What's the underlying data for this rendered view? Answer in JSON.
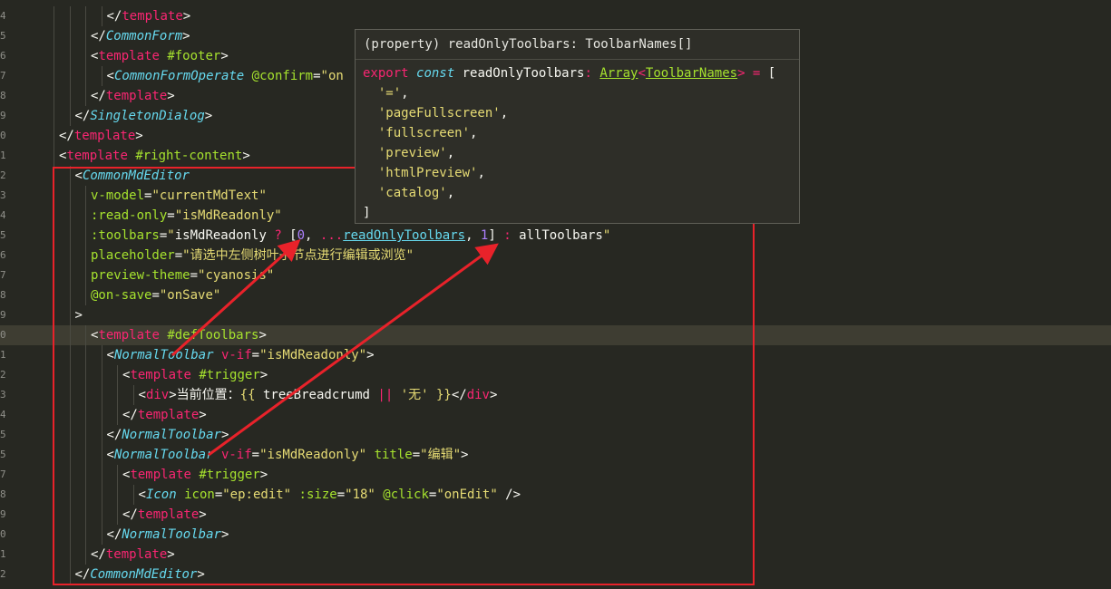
{
  "editor": {
    "current_line_index": 16,
    "lines": [
      {
        "n": "4",
        "indent": 6,
        "tokens": [
          [
            "punc",
            "</"
          ],
          [
            "tag",
            "template"
          ],
          [
            "punc",
            ">"
          ]
        ]
      },
      {
        "n": "5",
        "indent": 5,
        "tokens": [
          [
            "punc",
            "</"
          ],
          [
            "comp",
            "CommonForm"
          ],
          [
            "punc",
            ">"
          ]
        ]
      },
      {
        "n": "6",
        "indent": 5,
        "tokens": [
          [
            "punc",
            "<"
          ],
          [
            "tag",
            "template"
          ],
          [
            "punc",
            " "
          ],
          [
            "attr",
            "#footer"
          ],
          [
            "punc",
            ">"
          ]
        ]
      },
      {
        "n": "7",
        "indent": 6,
        "tokens": [
          [
            "punc",
            "<"
          ],
          [
            "comp",
            "CommonFormOperate"
          ],
          [
            "punc",
            " "
          ],
          [
            "attr",
            "@confirm"
          ],
          [
            "punc",
            "="
          ],
          [
            "str",
            "\"on"
          ]
        ]
      },
      {
        "n": "8",
        "indent": 5,
        "tokens": [
          [
            "punc",
            "</"
          ],
          [
            "tag",
            "template"
          ],
          [
            "punc",
            ">"
          ]
        ]
      },
      {
        "n": "9",
        "indent": 4,
        "tokens": [
          [
            "punc",
            "</"
          ],
          [
            "comp",
            "SingletonDialog"
          ],
          [
            "punc",
            ">"
          ]
        ]
      },
      {
        "n": "0",
        "indent": 3,
        "tokens": [
          [
            "punc",
            "</"
          ],
          [
            "tag",
            "template"
          ],
          [
            "punc",
            ">"
          ]
        ]
      },
      {
        "n": "1",
        "indent": 3,
        "tokens": [
          [
            "punc",
            "<"
          ],
          [
            "tag",
            "template"
          ],
          [
            "punc",
            " "
          ],
          [
            "attr",
            "#right-content"
          ],
          [
            "punc",
            ">"
          ]
        ]
      },
      {
        "n": "2",
        "indent": 4,
        "tokens": [
          [
            "punc",
            "<"
          ],
          [
            "comp",
            "CommonMdEditor"
          ]
        ]
      },
      {
        "n": "3",
        "indent": 5,
        "tokens": [
          [
            "attr",
            "v-model"
          ],
          [
            "punc",
            "="
          ],
          [
            "str",
            "\"currentMdText\""
          ]
        ]
      },
      {
        "n": "4",
        "indent": 5,
        "tokens": [
          [
            "attr",
            ":read-only"
          ],
          [
            "punc",
            "="
          ],
          [
            "str",
            "\"isMdReadonly\""
          ]
        ]
      },
      {
        "n": "5",
        "indent": 5,
        "tokens": [
          [
            "attr",
            ":toolbars"
          ],
          [
            "punc",
            "="
          ],
          [
            "str",
            "\""
          ],
          [
            "ident",
            "isMdReadonly "
          ],
          [
            "op",
            "?"
          ],
          [
            "punc",
            " ["
          ],
          [
            "num",
            "0"
          ],
          [
            "punc",
            ", "
          ],
          [
            "op",
            "..."
          ],
          [
            "link",
            "readOnlyToolbars"
          ],
          [
            "punc",
            ", "
          ],
          [
            "num",
            "1"
          ],
          [
            "punc",
            "] "
          ],
          [
            "op",
            ":"
          ],
          [
            "ident",
            " allToolbars"
          ],
          [
            "str",
            "\""
          ]
        ]
      },
      {
        "n": "6",
        "indent": 5,
        "tokens": [
          [
            "attr",
            "placeholder"
          ],
          [
            "punc",
            "="
          ],
          [
            "str",
            "\"请选中左侧树叶子节点进行编辑或浏览\""
          ]
        ]
      },
      {
        "n": "7",
        "indent": 5,
        "tokens": [
          [
            "attr",
            "preview-theme"
          ],
          [
            "punc",
            "="
          ],
          [
            "str",
            "\"cyanosis\""
          ]
        ]
      },
      {
        "n": "8",
        "indent": 5,
        "tokens": [
          [
            "attr",
            "@on-save"
          ],
          [
            "punc",
            "="
          ],
          [
            "str",
            "\"onSave\""
          ]
        ]
      },
      {
        "n": "9",
        "indent": 4,
        "tokens": [
          [
            "punc",
            ">"
          ]
        ]
      },
      {
        "n": "0",
        "indent": 5,
        "tokens": [
          [
            "punc",
            "<"
          ],
          [
            "tag",
            "template"
          ],
          [
            "punc",
            " "
          ],
          [
            "attr",
            "#defToolbars"
          ],
          [
            "punc",
            ">"
          ]
        ]
      },
      {
        "n": "1",
        "indent": 6,
        "tokens": [
          [
            "punc",
            "<"
          ],
          [
            "comp",
            "NormalToolbar"
          ],
          [
            "punc",
            " "
          ],
          [
            "tag",
            "v-if"
          ],
          [
            "punc",
            "="
          ],
          [
            "str",
            "\"isMdReadonly\""
          ],
          [
            "punc",
            ">"
          ]
        ]
      },
      {
        "n": "2",
        "indent": 7,
        "tokens": [
          [
            "punc",
            "<"
          ],
          [
            "tag",
            "template"
          ],
          [
            "punc",
            " "
          ],
          [
            "attr",
            "#trigger"
          ],
          [
            "punc",
            ">"
          ]
        ]
      },
      {
        "n": "3",
        "indent": 8,
        "tokens": [
          [
            "punc",
            "<"
          ],
          [
            "tag",
            "div"
          ],
          [
            "punc",
            ">当前位置："
          ],
          [
            "str",
            "{{"
          ],
          [
            "ident",
            " treeBreadcrumd "
          ],
          [
            "op",
            "||"
          ],
          [
            "punc",
            " "
          ],
          [
            "str",
            "'无'"
          ],
          [
            "punc",
            " "
          ],
          [
            "str",
            "}}"
          ],
          [
            "punc",
            "</"
          ],
          [
            "tag",
            "div"
          ],
          [
            "punc",
            ">"
          ]
        ]
      },
      {
        "n": "4",
        "indent": 7,
        "tokens": [
          [
            "punc",
            "</"
          ],
          [
            "tag",
            "template"
          ],
          [
            "punc",
            ">"
          ]
        ]
      },
      {
        "n": "5",
        "indent": 6,
        "tokens": [
          [
            "punc",
            "</"
          ],
          [
            "comp",
            "NormalToolbar"
          ],
          [
            "punc",
            ">"
          ]
        ]
      },
      {
        "n": "5",
        "indent": 6,
        "tokens": [
          [
            "punc",
            "<"
          ],
          [
            "comp",
            "NormalToolbar"
          ],
          [
            "punc",
            " "
          ],
          [
            "tag",
            "v-if"
          ],
          [
            "punc",
            "="
          ],
          [
            "str",
            "\"isMdReadonly\""
          ],
          [
            "punc",
            " "
          ],
          [
            "attr",
            "title"
          ],
          [
            "punc",
            "="
          ],
          [
            "str",
            "\"编辑\""
          ],
          [
            "punc",
            ">"
          ]
        ]
      },
      {
        "n": "7",
        "indent": 7,
        "tokens": [
          [
            "punc",
            "<"
          ],
          [
            "tag",
            "template"
          ],
          [
            "punc",
            " "
          ],
          [
            "attr",
            "#trigger"
          ],
          [
            "punc",
            ">"
          ]
        ]
      },
      {
        "n": "8",
        "indent": 8,
        "tokens": [
          [
            "punc",
            "<"
          ],
          [
            "comp",
            "Icon"
          ],
          [
            "punc",
            " "
          ],
          [
            "attr",
            "icon"
          ],
          [
            "punc",
            "="
          ],
          [
            "str",
            "\"ep:edit\""
          ],
          [
            "punc",
            " "
          ],
          [
            "attr",
            ":size"
          ],
          [
            "punc",
            "="
          ],
          [
            "str",
            "\"18\""
          ],
          [
            "punc",
            " "
          ],
          [
            "attr",
            "@click"
          ],
          [
            "punc",
            "="
          ],
          [
            "str",
            "\"onEdit\""
          ],
          [
            "punc",
            " />"
          ]
        ]
      },
      {
        "n": "9",
        "indent": 7,
        "tokens": [
          [
            "punc",
            "</"
          ],
          [
            "tag",
            "template"
          ],
          [
            "punc",
            ">"
          ]
        ]
      },
      {
        "n": "0",
        "indent": 6,
        "tokens": [
          [
            "punc",
            "</"
          ],
          [
            "comp",
            "NormalToolbar"
          ],
          [
            "punc",
            ">"
          ]
        ]
      },
      {
        "n": "1",
        "indent": 5,
        "tokens": [
          [
            "punc",
            "</"
          ],
          [
            "tag",
            "template"
          ],
          [
            "punc",
            ">"
          ]
        ]
      },
      {
        "n": "2",
        "indent": 4,
        "tokens": [
          [
            "punc",
            "</"
          ],
          [
            "comp",
            "CommonMdEditor"
          ],
          [
            "punc",
            ">"
          ]
        ]
      }
    ]
  },
  "hover": {
    "header": "(property) readOnlyToolbars: ToolbarNames[]",
    "lines": [
      [
        [
          "kw",
          "export "
        ],
        [
          "kwi",
          "const "
        ],
        [
          "ident",
          "readOnlyToolbars"
        ],
        [
          "kw",
          ": "
        ],
        [
          "typeu",
          "Array"
        ],
        [
          "kw",
          "<"
        ],
        [
          "typeu",
          "ToolbarNames"
        ],
        [
          "kw",
          "> = "
        ],
        [
          "ident",
          "["
        ]
      ],
      [
        [
          "ident",
          "  "
        ],
        [
          "str",
          "'='"
        ],
        [
          "ident",
          ","
        ]
      ],
      [
        [
          "ident",
          "  "
        ],
        [
          "str",
          "'pageFullscreen'"
        ],
        [
          "ident",
          ","
        ]
      ],
      [
        [
          "ident",
          "  "
        ],
        [
          "str",
          "'fullscreen'"
        ],
        [
          "ident",
          ","
        ]
      ],
      [
        [
          "ident",
          "  "
        ],
        [
          "str",
          "'preview'"
        ],
        [
          "ident",
          ","
        ]
      ],
      [
        [
          "ident",
          "  "
        ],
        [
          "str",
          "'htmlPreview'"
        ],
        [
          "ident",
          ","
        ]
      ],
      [
        [
          "ident",
          "  "
        ],
        [
          "str",
          "'catalog'"
        ],
        [
          "ident",
          ","
        ]
      ],
      [
        [
          "ident",
          "]"
        ]
      ]
    ]
  },
  "annotation": {
    "box_color": "#e8222a",
    "arrow_color": "#e8222a"
  }
}
